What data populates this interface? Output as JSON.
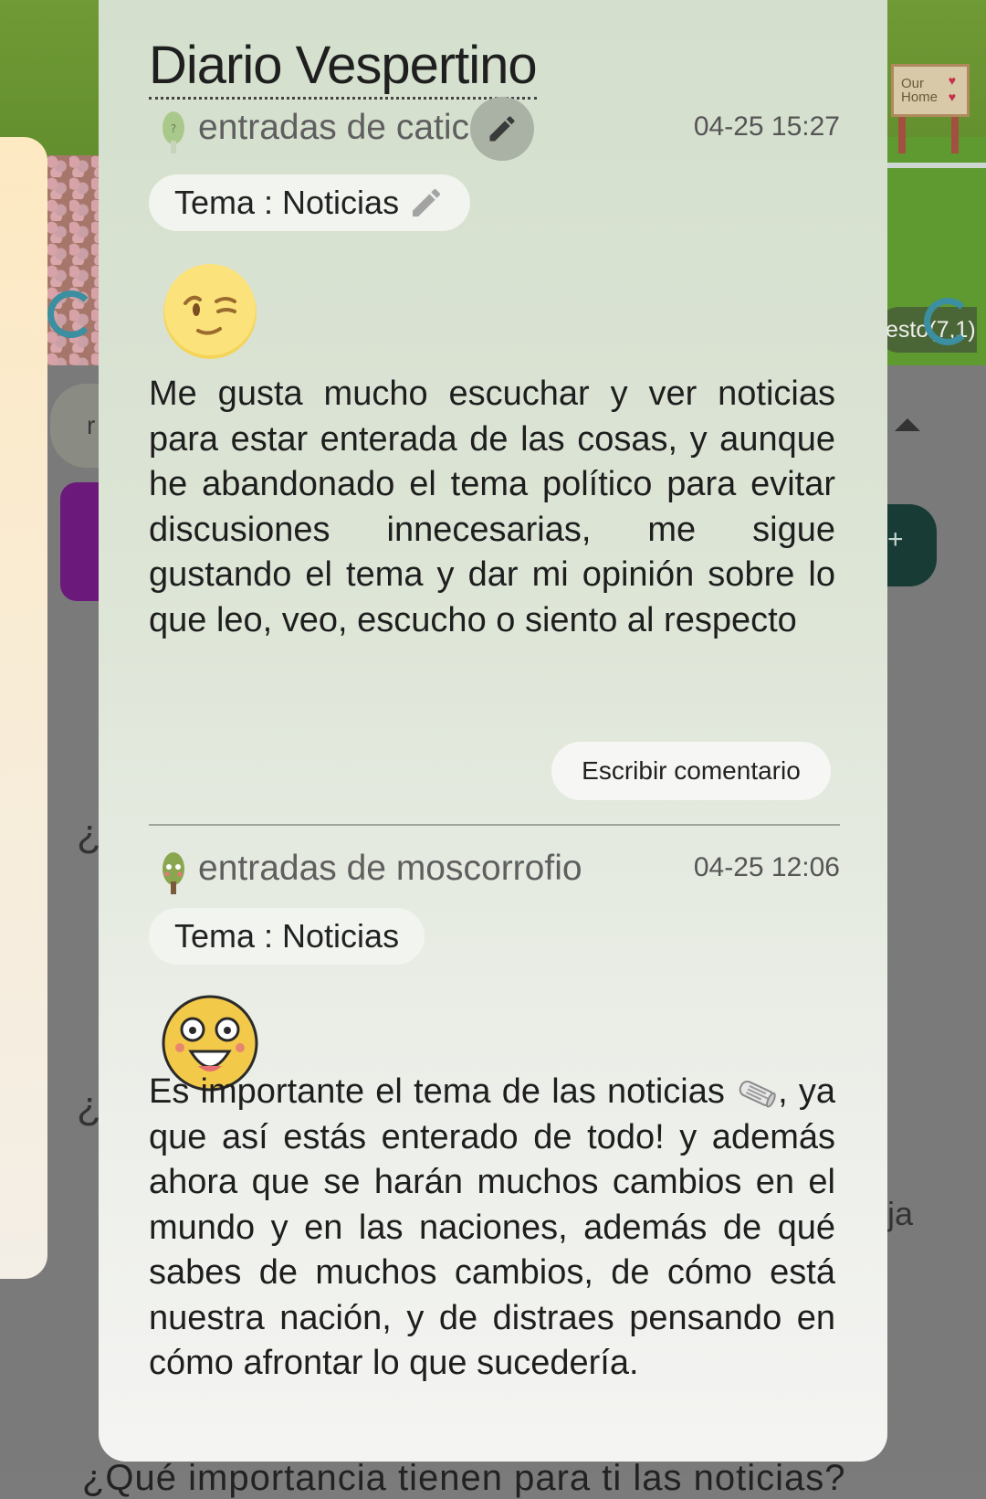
{
  "background": {
    "sign_line1": "Our",
    "sign_line2": "Home",
    "location": "esto(7,1)",
    "left_pill_fragment": "r",
    "question_fragment": "¿",
    "right_fragment": "ja",
    "bottom_text": "¿Qué importancia tienen para ti las noticias?"
  },
  "diary": {
    "title": "Diario Vespertino",
    "entries": [
      {
        "author": "entradas de catica",
        "date": "04-25 15:27",
        "topic": "Tema : Noticias",
        "emoji": "winking-face",
        "text": "Me gusta mucho escuchar y ver noticias para estar enterada de las cosas, y aunque he abandonado el tema político para evitar discusiones innecesarias, me sigue gustando el tema y dar mi opinión sobre lo que leo, veo, escucho o siento al respecto",
        "comment_button": "Escribir comentario"
      },
      {
        "author": "entradas de moscorrofio",
        "date": "04-25 12:06",
        "topic": "Tema : Noticias",
        "emoji": "shocked-face",
        "text_part1": "Es importante el tema de las noticias",
        "text_part2": ", ya que así estás enterado de todo! y además ahora que se harán muchos cambios en el mundo y en las naciones, además de qué sabes de muchos cambios, de cómo está nuestra nación, y de distraes pensando en cómo afrontar lo que sucedería."
      }
    ]
  },
  "colors": {
    "modal_top": "#d4dfcd",
    "modal_bottom": "#f4f4f2",
    "pill": "#f2f4ef",
    "edit_circle": "#a9b2a4"
  }
}
